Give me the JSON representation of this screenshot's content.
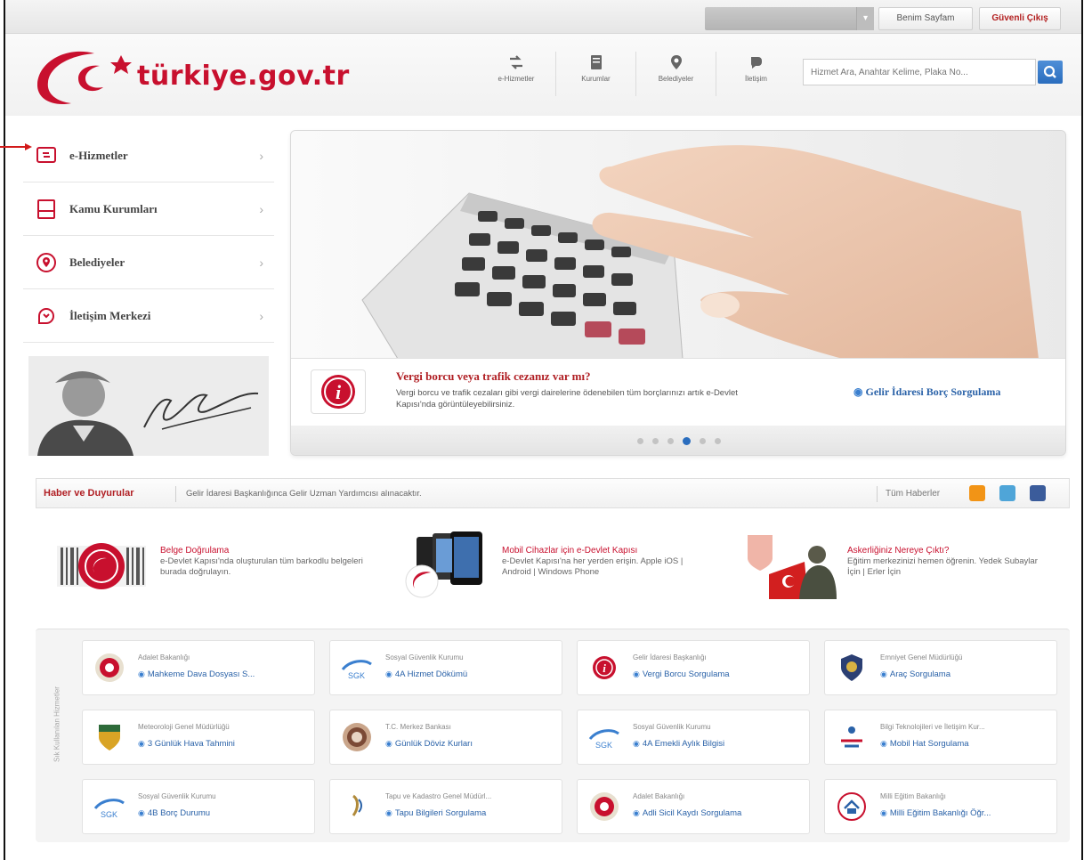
{
  "top": {
    "benim_sayfam": "Benim Sayfam",
    "guvenli_cikis": "Güvenli Çıkış"
  },
  "header": {
    "logo_text": "türkiye.gov.tr",
    "nav": [
      {
        "label": "e-Hizmetler",
        "icon": "services-icon"
      },
      {
        "label": "Kurumlar",
        "icon": "institutions-icon"
      },
      {
        "label": "Belediyeler",
        "icon": "location-pin-icon"
      },
      {
        "label": "İletişim",
        "icon": "contact-icon"
      }
    ],
    "search_placeholder": "Hizmet Ara, Anahtar Kelime, Plaka No..."
  },
  "sidebar": {
    "items": [
      {
        "label": "e-Hizmetler"
      },
      {
        "label": "Kamu Kurumları"
      },
      {
        "label": "Belediyeler"
      },
      {
        "label": "İletişim Merkezi"
      }
    ]
  },
  "slider": {
    "title": "Vergi borcu veya trafik cezanız var mı?",
    "body": "Vergi borcu ve trafik cezaları gibi vergi dairelerine ödenebilen tüm borçlarınızı artık e-Devlet Kapısı'nda görüntüleyebilirsiniz.",
    "link": "Gelir İdaresi Borç Sorgulama",
    "dot_count": 6,
    "active_dot": 4
  },
  "news": {
    "label": "Haber ve Duyurular",
    "headline": "Gelir İdaresi Başkanlığınca Gelir Uzman Yardımcısı alınacaktır.",
    "all": "Tüm Haberler"
  },
  "promos": [
    {
      "title": "Belge Doğrulama",
      "body": "e-Devlet Kapısı'nda oluşturulan tüm barkodlu belgeleri burada doğrulayın."
    },
    {
      "title": "Mobil Cihazlar için e-Devlet Kapısı",
      "body": "e-Devlet Kapısı'na her yerden erişin. Apple iOS | Android | Windows Phone"
    },
    {
      "title": "Askerliğiniz Nereye Çıktı?",
      "body": "Eğitim merkezinizi hemen öğrenin. Yedek Subaylar İçin | Erler İçin"
    }
  ],
  "freq": {
    "label": "Sık Kullanılan Hizmetler",
    "cards": [
      {
        "org": "Adalet Bakanlığı",
        "service": "Mahkeme Dava Dosyası S..."
      },
      {
        "org": "Sosyal Güvenlik Kurumu",
        "service": "4A Hizmet Dökümü"
      },
      {
        "org": "Gelir İdaresi Başkanlığı",
        "service": "Vergi Borcu Sorgulama"
      },
      {
        "org": "Emniyet Genel Müdürlüğü",
        "service": "Araç Sorgulama"
      },
      {
        "org": "Meteoroloji Genel Müdürlüğü",
        "service": "3 Günlük Hava Tahmini"
      },
      {
        "org": "T.C. Merkez Bankası",
        "service": "Günlük Döviz Kurları"
      },
      {
        "org": "Sosyal Güvenlik Kurumu",
        "service": "4A Emekli Aylık Bilgisi"
      },
      {
        "org": "Bilgi Teknolojileri ve İletişim Kur...",
        "service": "Mobil Hat Sorgulama"
      },
      {
        "org": "Sosyal Güvenlik Kurumu",
        "service": "4B Borç Durumu"
      },
      {
        "org": "Tapu ve Kadastro Genel Müdürl...",
        "service": "Tapu Bilgileri Sorgulama"
      },
      {
        "org": "Adalet Bakanlığı",
        "service": "Adli Sicil Kaydı Sorgulama"
      },
      {
        "org": "Milli Eğitim Bakanlığı",
        "service": "Milli Eğitim Bakanlığı Öğr..."
      }
    ]
  },
  "colors": {
    "brand_red": "#c8102e",
    "link_blue": "#2a62a8",
    "accent_blue": "#2a6dbe"
  }
}
